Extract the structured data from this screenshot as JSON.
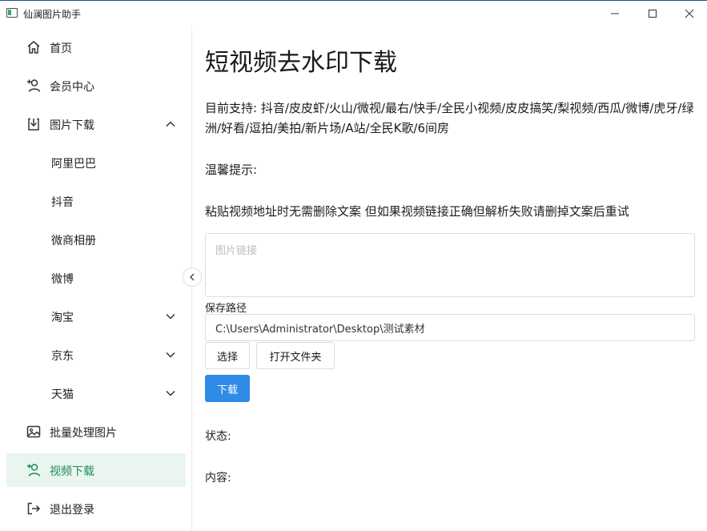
{
  "window": {
    "title": "仙澜图片助手"
  },
  "sidebar": {
    "items": [
      {
        "label": "首页",
        "icon": "home-icon"
      },
      {
        "label": "会员中心",
        "icon": "user-plus-icon"
      },
      {
        "label": "图片下载",
        "icon": "download-icon",
        "expanded": true
      },
      {
        "label": "阿里巴巴"
      },
      {
        "label": "抖音"
      },
      {
        "label": "微商相册"
      },
      {
        "label": "微博"
      },
      {
        "label": "淘宝",
        "expandable": true
      },
      {
        "label": "京东",
        "expandable": true
      },
      {
        "label": "天猫",
        "expandable": true
      },
      {
        "label": "批量处理图片",
        "icon": "image-icon"
      },
      {
        "label": "视频下载",
        "icon": "user-plus-icon",
        "active": true
      },
      {
        "label": "退出登录",
        "icon": "logout-icon"
      }
    ]
  },
  "main": {
    "title": "短视频去水印下载",
    "support_text": "目前支持: 抖音/皮皮虾/火山/微视/最右/快手/全民小视频/皮皮搞笑/梨视频/西瓜/微博/虎牙/绿洲/好看/逗拍/美拍/新片场/A站/全民K歌/6间房",
    "tip_title": "温馨提示:",
    "tip_body": "粘贴视频地址时无需删除文案 但如果视频链接正确但解析失败请删掉文案后重试",
    "link_placeholder": "图片链接",
    "path_label": "保存路径",
    "path_value": "C:\\Users\\Administrator\\Desktop\\测试素材",
    "choose_label": "选择",
    "open_folder_label": "打开文件夹",
    "download_label": "下载",
    "status_label": "状态:",
    "content_label": "内容:"
  },
  "colors": {
    "accent": "#2f8be6",
    "active_bg": "#e9f5ee",
    "active_fg": "#1f8a55"
  }
}
